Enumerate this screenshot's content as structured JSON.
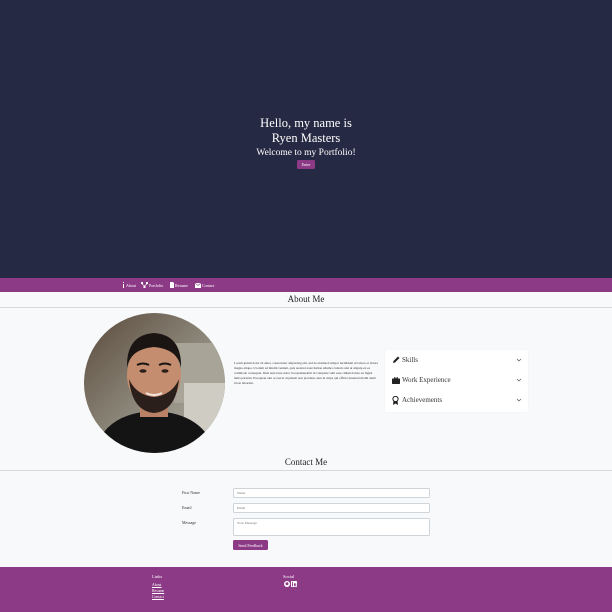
{
  "hero": {
    "line1": "Hello, my name is",
    "line2": "Ryen Masters",
    "line3": "Welcome to my Portfolio!",
    "enter_label": "Enter"
  },
  "nav": {
    "items": [
      {
        "label": "About",
        "icon": "info-icon"
      },
      {
        "label": "Portfolio",
        "icon": "sitemap-icon"
      },
      {
        "label": "Resume",
        "icon": "file-icon"
      },
      {
        "label": "Contact",
        "icon": "envelope-icon"
      }
    ]
  },
  "about": {
    "title": "About Me",
    "body": "Lorem ipsum dolor sit amet, consectetur adipiscing elit, sed do eiusmod tempor incididunt ut labore et dolore magna aliqua. Ut enim ad minim veniam, quis nostrud exercitation ullamco laboris nisi ut aliquip ex ea commodo consequat. Duis aute irure dolor in reprehenderit in voluptate velit esse cillum dolore eu fugiat nulla pariatur. Excepteur sint occaecat cupidatat non proident, sunt in culpa qui officia deserunt mollit anim id est laborum.",
    "accordion": [
      {
        "label": "Skills",
        "icon": "pencil-icon"
      },
      {
        "label": "Work Experience",
        "icon": "briefcase-icon"
      },
      {
        "label": "Achievements",
        "icon": "award-icon"
      }
    ]
  },
  "contact": {
    "title": "Contact Me",
    "first_name_label": "First Name",
    "first_name_placeholder": "Name",
    "email_label": "Email",
    "email_placeholder": "Email",
    "message_label": "Message",
    "message_placeholder": "Your Message",
    "submit_label": "Send Feedback"
  },
  "footer": {
    "links_heading": "Links",
    "links": [
      "About",
      "Resume",
      "Contact"
    ],
    "social_heading": "Social",
    "social_icons": [
      "github-icon",
      "linkedin-icon"
    ]
  },
  "colors": {
    "hero_bg": "#262943",
    "accent": "#8c3a86",
    "page_bg": "#f8f9fa"
  }
}
